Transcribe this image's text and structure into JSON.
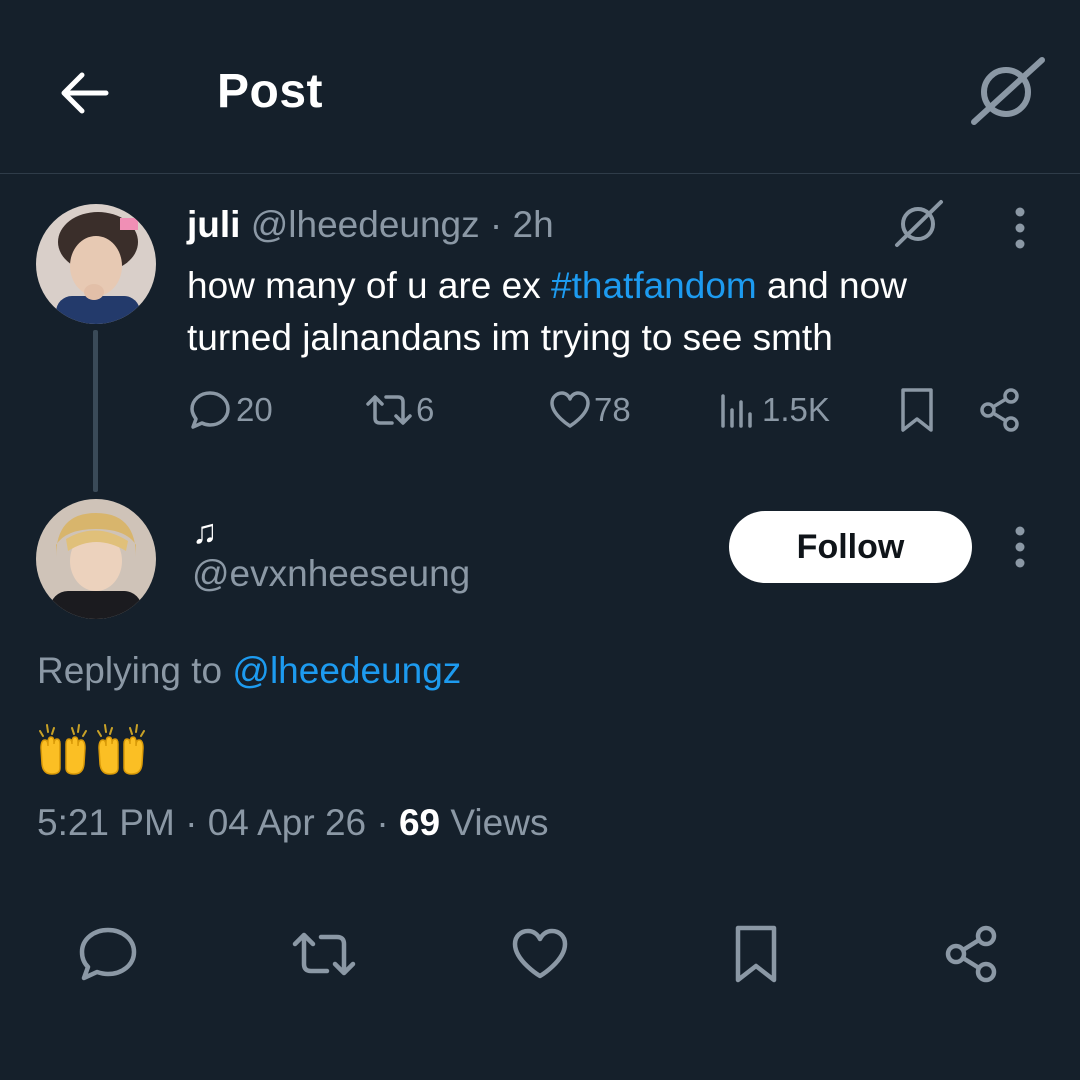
{
  "header": {
    "title": "Post",
    "back_icon": "arrow-left-icon",
    "grok_icon": "grok-icon"
  },
  "parent_post": {
    "display_name": "juli",
    "handle": "@lheedeungz",
    "separator": "·",
    "time": "2h",
    "text_before": "how many of u are ex ",
    "hashtag": "#thatfandom",
    "text_after": " and now turned jalnandans im trying to see smth",
    "replies": "20",
    "reposts": "6",
    "likes": "78",
    "views": "1.5K"
  },
  "main_post": {
    "display_name": "♫",
    "handle": "@evxnheeseung",
    "follow_label": "Follow",
    "replying_prefix": "Replying to ",
    "replying_to": "@lheedeungz",
    "body_emoji": "🙌🙌",
    "time": "5:21 PM",
    "date": "04 Apr 26",
    "separator": "·",
    "views_count": "69",
    "views_label": "Views"
  },
  "colors": {
    "background": "#15202b",
    "accent": "#1d9bf0",
    "muted": "#8b98a5",
    "text": "#ffffff"
  }
}
